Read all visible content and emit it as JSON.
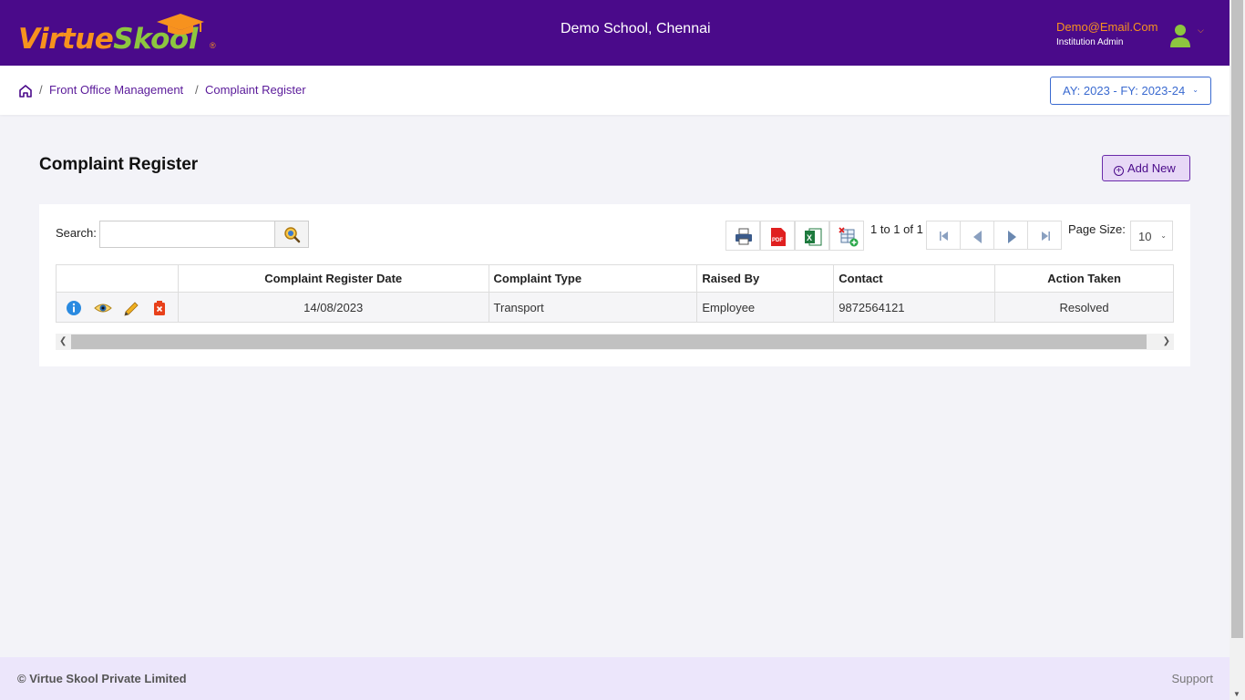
{
  "header": {
    "logo_part1": "Virtue",
    "logo_part2": "Skool",
    "logo_reg": "®",
    "school_name": "Demo School, Chennai",
    "user_email": "Demo@Email.Com",
    "user_role": "Institution Admin"
  },
  "breadcrumb": {
    "items": [
      "Front Office Management",
      "Complaint Register"
    ],
    "separator": "/",
    "academic_year": "AY: 2023 - FY: 2023-24"
  },
  "page": {
    "title": "Complaint Register",
    "add_new_label": "Add New"
  },
  "toolbar": {
    "search_label": "Search:",
    "search_value": "",
    "pager_info": "1 to 1 of 1",
    "page_size_label": "Page Size:",
    "page_size_value": "10"
  },
  "table": {
    "columns": [
      "",
      "Complaint Register Date",
      "Complaint Type",
      "Raised By",
      "Contact",
      "Action Taken"
    ],
    "rows": [
      {
        "date": "14/08/2023",
        "type": "Transport",
        "raised_by": "Employee",
        "contact": "9872564121",
        "action_taken": "Resolved"
      }
    ]
  },
  "footer": {
    "copyright": "© Virtue Skool Private Limited",
    "support": "Support"
  },
  "colors": {
    "header_bg": "#4a0a8a",
    "accent_orange": "#f7921e",
    "accent_green": "#8dc63f",
    "link_purple": "#5a1a9a",
    "footer_bg": "#ece6fb"
  }
}
